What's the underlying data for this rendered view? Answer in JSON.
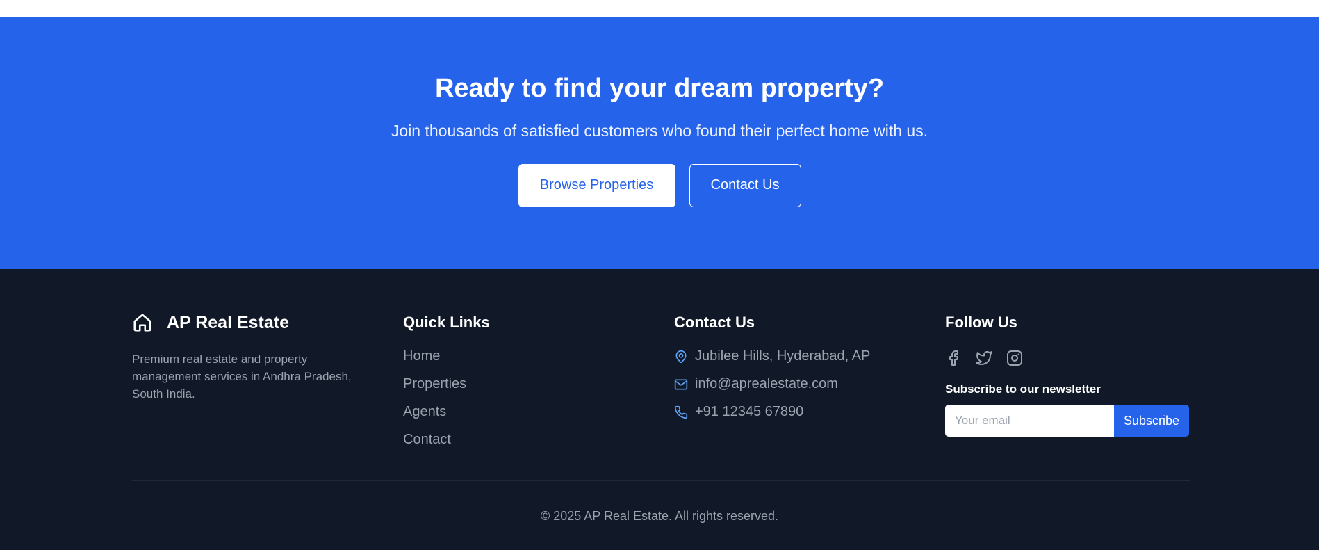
{
  "cta": {
    "title": "Ready to find your dream property?",
    "subtitle": "Join thousands of satisfied customers who found their perfect home with us.",
    "browse_label": "Browse Properties",
    "contact_label": "Contact Us"
  },
  "footer": {
    "brand": {
      "name": "AP Real Estate",
      "icon": "home-icon",
      "description": "Premium real estate and property management services in Andhra Pradesh, South India."
    },
    "quick_links": {
      "title": "Quick Links",
      "items": [
        "Home",
        "Properties",
        "Agents",
        "Contact"
      ]
    },
    "contact": {
      "title": "Contact Us",
      "address": "Jubilee Hills, Hyderabad, AP",
      "email": "info@aprealestate.com",
      "phone": "+91 12345 67890"
    },
    "follow": {
      "title": "Follow Us",
      "socials": [
        "facebook-icon",
        "twitter-icon",
        "instagram-icon"
      ],
      "newsletter_title": "Subscribe to our newsletter",
      "email_placeholder": "Your email",
      "subscribe_label": "Subscribe"
    },
    "copyright": "© 2025 AP Real Estate. All rights reserved."
  },
  "colors": {
    "accent": "#2563eb",
    "footer_bg": "#111827",
    "muted_text": "#9ca3af"
  }
}
